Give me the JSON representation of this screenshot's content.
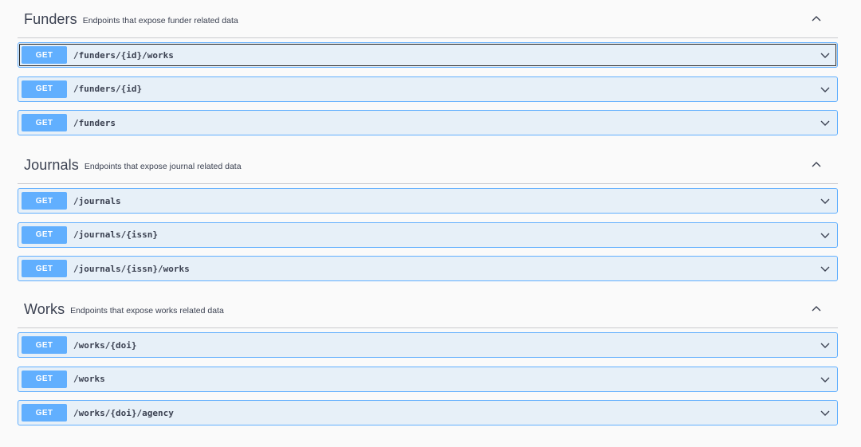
{
  "sections": [
    {
      "title": "Funders",
      "description": "Endpoints that expose funder related data",
      "operations": [
        {
          "method": "GET",
          "path": "/funders/{id}/works"
        },
        {
          "method": "GET",
          "path": "/funders/{id}"
        },
        {
          "method": "GET",
          "path": "/funders"
        }
      ]
    },
    {
      "title": "Journals",
      "description": "Endpoints that expose journal related data",
      "operations": [
        {
          "method": "GET",
          "path": "/journals"
        },
        {
          "method": "GET",
          "path": "/journals/{issn}"
        },
        {
          "method": "GET",
          "path": "/journals/{issn}/works"
        }
      ]
    },
    {
      "title": "Works",
      "description": "Endpoints that expose works related data",
      "operations": [
        {
          "method": "GET",
          "path": "/works/{doi}"
        },
        {
          "method": "GET",
          "path": "/works"
        },
        {
          "method": "GET",
          "path": "/works/{doi}/agency"
        }
      ]
    }
  ],
  "icons": {
    "collapse": "chevron-up-icon",
    "expand": "chevron-down-icon"
  },
  "colors": {
    "get_method": "#61affe",
    "get_background": "#e7f0f8",
    "text": "#3b4151"
  }
}
